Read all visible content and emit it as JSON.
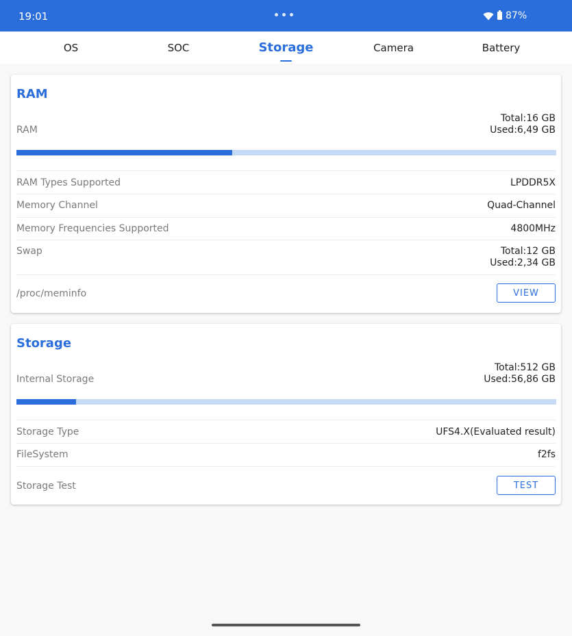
{
  "status_bar": {
    "time": "19:01",
    "battery": "87%",
    "icons": [
      "wifi-icon",
      "battery-icon",
      "more-dots-icon"
    ]
  },
  "tabs": [
    {
      "label": "OS"
    },
    {
      "label": "SOC"
    },
    {
      "label": "Storage",
      "active": true
    },
    {
      "label": "Camera"
    },
    {
      "label": "Battery"
    }
  ],
  "ram_card": {
    "title": "RAM",
    "usage": {
      "label": "RAM",
      "total": "Total:16 GB",
      "used": "Used:6,49 GB",
      "used_fraction": 0.4
    },
    "rows": [
      {
        "label": "RAM Types Supported",
        "value": "LPDDR5X"
      },
      {
        "label": "Memory Channel",
        "value": "Quad-Channel"
      },
      {
        "label": "Memory Frequencies Supported",
        "value": "4800MHz"
      }
    ],
    "swap": {
      "label": "Swap",
      "total": "Total:12 GB",
      "used": "Used:2,34 GB"
    },
    "meminfo": {
      "label": "/proc/meminfo",
      "button": "VIEW"
    }
  },
  "storage_card": {
    "title": "Storage",
    "usage": {
      "label": "Internal Storage",
      "total": "Total:512 GB",
      "used": "Used:56,86 GB",
      "used_fraction": 0.11
    },
    "rows": [
      {
        "label": "Storage Type",
        "value": "UFS4.X(Evaluated result)"
      },
      {
        "label": "FileSystem",
        "value": "f2fs"
      }
    ],
    "test": {
      "label": "Storage Test",
      "button": "TEST"
    }
  },
  "colors": {
    "accent": "#2a6edb",
    "bar_track": "#c6d9f5",
    "background": "#f8f8f8"
  }
}
